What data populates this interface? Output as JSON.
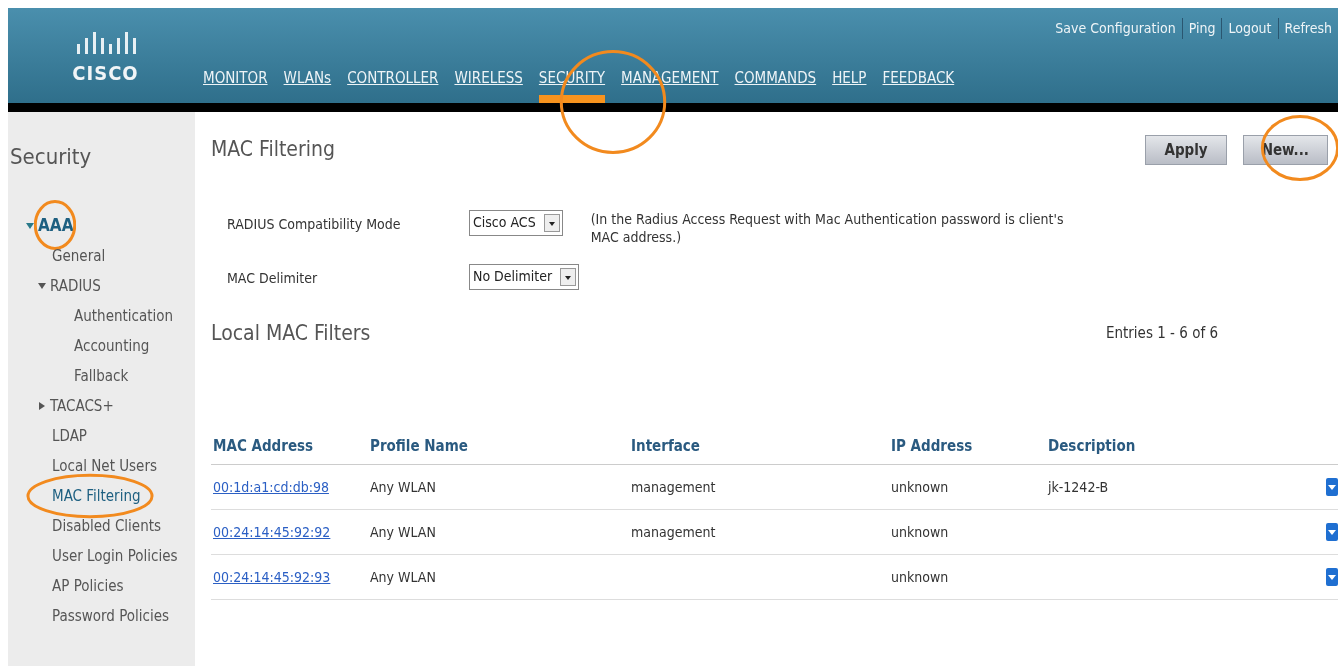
{
  "header": {
    "logo": "CISCO",
    "nav": [
      {
        "label": "MONITOR",
        "selected": false
      },
      {
        "label": "WLANs",
        "selected": false
      },
      {
        "label": "CONTROLLER",
        "selected": false
      },
      {
        "label": "WIRELESS",
        "selected": false
      },
      {
        "label": "SECURITY",
        "selected": true
      },
      {
        "label": "MANAGEMENT",
        "selected": false
      },
      {
        "label": "COMMANDS",
        "selected": false
      },
      {
        "label": "HELP",
        "selected": false
      },
      {
        "label": "FEEDBACK",
        "selected": false
      }
    ],
    "links": [
      "Save Configuration",
      "Ping",
      "Logout",
      "Refresh"
    ]
  },
  "sidebar": {
    "title": "Security",
    "items": [
      {
        "label": "AAA",
        "selected": false,
        "expanded": true,
        "children": [
          {
            "label": "General",
            "selected": false
          },
          {
            "label": "RADIUS",
            "selected": false,
            "expanded": true,
            "children": [
              {
                "label": "Authentication",
                "selected": false
              },
              {
                "label": "Accounting",
                "selected": false
              },
              {
                "label": "Fallback",
                "selected": false
              }
            ]
          },
          {
            "label": "TACACS+",
            "selected": false,
            "expanded": false
          },
          {
            "label": "LDAP",
            "selected": false
          },
          {
            "label": "Local Net Users",
            "selected": false
          },
          {
            "label": "MAC Filtering",
            "selected": true
          },
          {
            "label": "Disabled Clients",
            "selected": false
          },
          {
            "label": "User Login Policies",
            "selected": false
          },
          {
            "label": "AP Policies",
            "selected": false
          },
          {
            "label": "Password Policies",
            "selected": false
          }
        ]
      }
    ]
  },
  "page": {
    "title": "MAC Filtering",
    "buttons": [
      "Apply",
      "New..."
    ],
    "settings": [
      {
        "label": "RADIUS Compatibility Mode",
        "value": "Cisco ACS",
        "note": "(In the Radius Access Request with Mac Authentication password is client's MAC address.)"
      },
      {
        "label": "MAC Delimiter",
        "value": "No Delimiter"
      }
    ],
    "section_title": "Local MAC Filters",
    "entries": "Entries 1 - 6 of 6",
    "table": {
      "columns": [
        "MAC Address",
        "Profile Name",
        "Interface",
        "IP Address",
        "Description"
      ],
      "rows": [
        [
          "00:1d:a1:cd:db:98",
          "Any WLAN",
          "management",
          "unknown",
          "jk-1242-B"
        ],
        [
          "00:24:14:45:92:92",
          "Any WLAN",
          "management",
          "unknown",
          ""
        ],
        [
          "00:24:14:45:92:93",
          "Any WLAN",
          "",
          "unknown",
          ""
        ]
      ]
    }
  }
}
